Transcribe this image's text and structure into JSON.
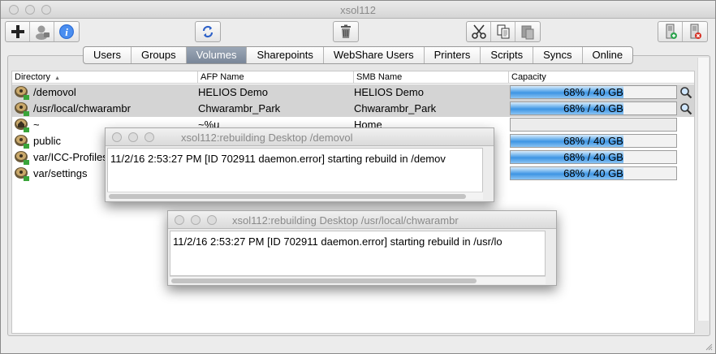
{
  "window": {
    "title": "xsol112"
  },
  "toolbar": {
    "left_group": [
      "add-icon",
      "user-lock-icon",
      "info-icon"
    ],
    "refresh": "refresh-icon",
    "trash": "trash-icon",
    "edit_group": [
      "cut-icon",
      "copy-icon",
      "paste-icon"
    ],
    "right_icons": [
      "server-add-icon",
      "server-remove-icon"
    ]
  },
  "tabs": [
    {
      "label": "Users"
    },
    {
      "label": "Groups"
    },
    {
      "label": "Volumes",
      "active": true
    },
    {
      "label": "Sharepoints"
    },
    {
      "label": "WebShare Users"
    },
    {
      "label": "Printers"
    },
    {
      "label": "Scripts"
    },
    {
      "label": "Syncs"
    },
    {
      "label": "Online"
    }
  ],
  "table": {
    "columns": {
      "directory": "Directory",
      "sort_indicator": "▲",
      "afp": "AFP Name",
      "smb": "SMB Name",
      "capacity": "Capacity"
    },
    "rows": [
      {
        "directory": "/demovol",
        "afp": "HELIOS Demo",
        "smb": "HELIOS Demo",
        "capacity": "68%  / 40 GB",
        "fill": 0.68,
        "selected": true,
        "search": true
      },
      {
        "directory": "/usr/local/chwarambr",
        "afp": "Chwarambr_Park",
        "smb": "Chwarambr_Park",
        "capacity": "68%  / 40 GB",
        "fill": 0.68,
        "selected": true,
        "search": true
      },
      {
        "directory": "~",
        "afp": "~%u",
        "smb": "Home",
        "capacity": "",
        "fill": 0,
        "selected": false,
        "search": false
      },
      {
        "directory": "public",
        "afp": "",
        "smb": "",
        "capacity": "68%  / 40 GB",
        "fill": 0.68,
        "selected": false,
        "search": false
      },
      {
        "directory": "var/ICC-Profiles",
        "afp": "",
        "smb": "",
        "capacity": "68%  / 40 GB",
        "fill": 0.68,
        "selected": false,
        "search": false
      },
      {
        "directory": "var/settings",
        "afp": "",
        "smb": "",
        "capacity": "68%  / 40 GB",
        "fill": 0.68,
        "selected": false,
        "search": false
      }
    ]
  },
  "log1": {
    "title": "xsol112:rebuilding Desktop /demovol",
    "text": "11/2/16 2:53:27 PM [ID 702911 daemon.error] starting rebuild in /demov"
  },
  "log2": {
    "title": "xsol112:rebuilding Desktop /usr/local/chwarambr",
    "text": "11/2/16 2:53:27 PM [ID 702911 daemon.error] starting rebuild in /usr/lo"
  },
  "colors": {
    "selected_tab": "#7f8c9e",
    "selected_row": "#d4d4d4",
    "capacity_fill": "#3e95e4"
  }
}
